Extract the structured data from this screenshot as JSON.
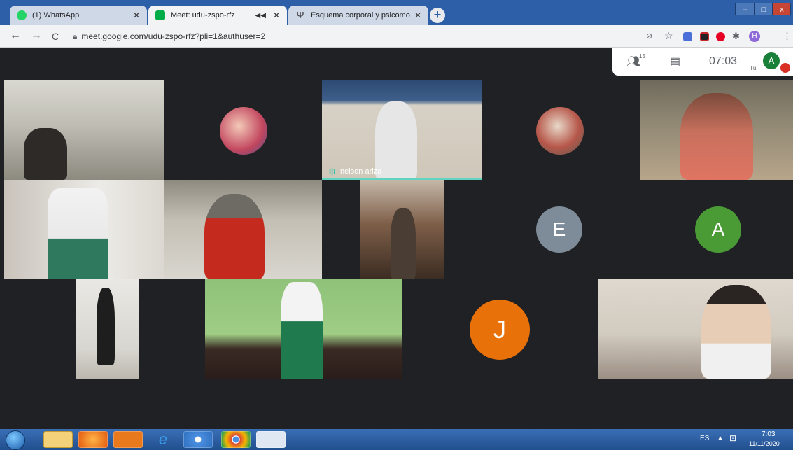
{
  "browser": {
    "tabs": [
      {
        "title": "(1) WhatsApp",
        "fav_color": "#25d366",
        "active": false
      },
      {
        "title": "Meet: udu-zspo-rfz",
        "fav_color": "#00ac47",
        "active": true
      },
      {
        "title": "Esquema corporal y psicomotricio",
        "fav_glyph": "Ψ",
        "active": false
      }
    ],
    "new_tab": "+",
    "window_controls": {
      "minimize": "–",
      "maximize": "□",
      "close": "x"
    },
    "nav": {
      "back": "←",
      "forward": "→",
      "reload": "C"
    },
    "url": "meet.google.com/udu-zspo-rfz?pli=1&authuser=2",
    "profile_initial": "H"
  },
  "meet": {
    "participants_count": "15",
    "clock": "07:03",
    "you_label": "Tú",
    "user_initial": "A",
    "participants": [
      {
        "name": "nelson ariza",
        "speaking": true
      }
    ],
    "initial_tiles": [
      {
        "letter": "E",
        "color": "#7e8c99"
      },
      {
        "letter": "A",
        "color": "#4a9a36"
      },
      {
        "letter": "J",
        "color": "#e8710a"
      }
    ]
  },
  "taskbar": {
    "language": "ES",
    "time": "7:03",
    "date": "11/11/2020"
  }
}
